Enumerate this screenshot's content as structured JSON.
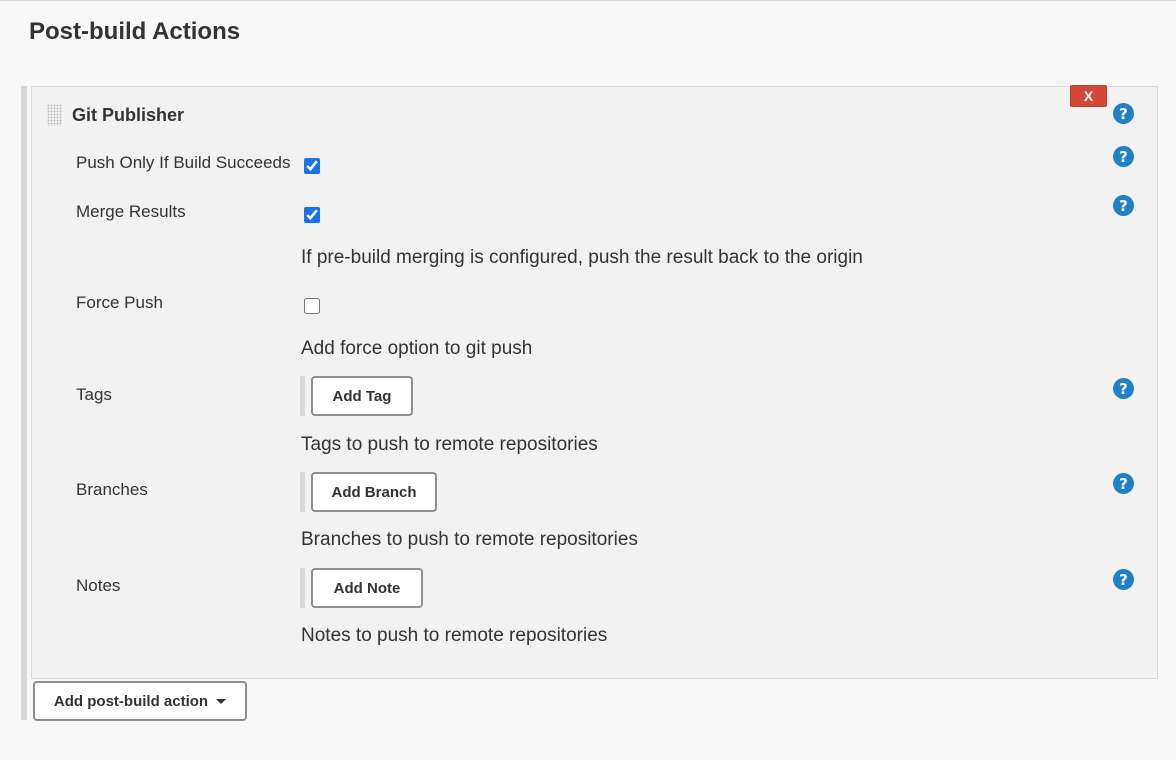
{
  "section": {
    "title": "Post-build Actions"
  },
  "publisher": {
    "title": "Git Publisher",
    "delete_label": "X",
    "help_glyph": "?",
    "fields": {
      "push_only": {
        "label": "Push Only If Build Succeeds",
        "checked": true
      },
      "merge_results": {
        "label": "Merge Results",
        "checked": true,
        "description": "If pre-build merging is configured, push the result back to the origin"
      },
      "force_push": {
        "label": "Force Push",
        "checked": false,
        "description": "Add force option to git push"
      },
      "tags": {
        "label": "Tags",
        "button": "Add Tag",
        "description": "Tags to push to remote repositories"
      },
      "branches": {
        "label": "Branches",
        "button": "Add Branch",
        "description": "Branches to push to remote repositories"
      },
      "notes": {
        "label": "Notes",
        "button": "Add Note",
        "description": "Notes to push to remote repositories"
      }
    }
  },
  "footer": {
    "add_action_label": "Add post-build action"
  },
  "colors": {
    "help": "#1f7fc7",
    "delete": "#d24939",
    "card_bg": "#f2f2f2"
  },
  "icons": [
    "drag-handle-icon",
    "help-icon",
    "caret-down-icon"
  ]
}
